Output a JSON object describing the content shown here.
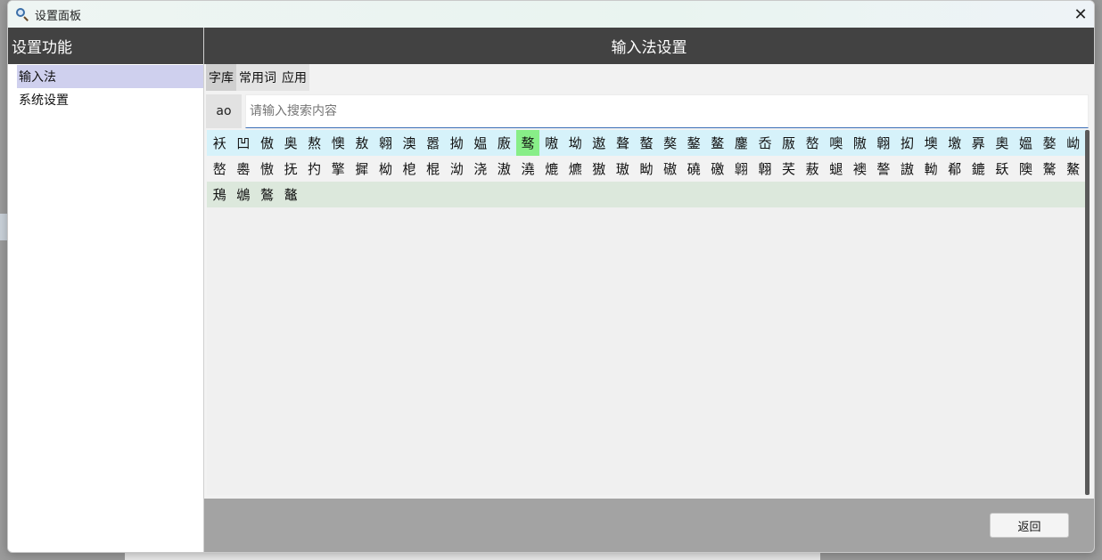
{
  "window": {
    "title": "设置面板",
    "close_glyph": "✕"
  },
  "sidebar": {
    "header": "设置功能",
    "items": [
      {
        "label": "输入法",
        "active": true
      },
      {
        "label": "系统设置",
        "active": false
      }
    ]
  },
  "main": {
    "header": "输入法设置",
    "tabs": [
      {
        "label": "字库",
        "active": true
      },
      {
        "label": "常用词",
        "active": false
      },
      {
        "label": "应用",
        "active": false
      }
    ],
    "search": {
      "pinyin": "ao",
      "placeholder": "请输入搜索内容",
      "value": ""
    },
    "char_rows": [
      [
        "袄",
        "凹",
        "傲",
        "奥",
        "熬",
        "懊",
        "敖",
        "翱",
        "澳",
        "嚣",
        "拗",
        "媪",
        "廒",
        "骜",
        "嗷",
        "坳",
        "遨",
        "聱",
        "螯",
        "獒",
        "鏊",
        "鳌",
        "鏖",
        "岙",
        "厫",
        "嶅",
        "噢",
        "隞",
        "翺",
        "抝",
        "墺",
        "墽",
        "奡",
        "奧",
        "媼",
        "嫯",
        "岰"
      ],
      [
        "嶅",
        "嶴",
        "慠",
        "抚",
        "扚",
        "擎",
        "摨",
        "柪",
        "梎",
        "棍",
        "泑",
        "浇",
        "滶",
        "澆",
        "熝",
        "爊",
        "獓",
        "璈",
        "眑",
        "磝",
        "磽",
        "礉",
        "翶",
        "翺",
        "芺",
        "蔜",
        "螁",
        "襖",
        "謷",
        "謸",
        "軪",
        "郩",
        "鏕",
        "镺",
        "隩",
        "驁",
        "鰲"
      ],
      [
        "鴁",
        "鴢",
        "鷔",
        "鼇"
      ]
    ],
    "highlighted": {
      "row": 0,
      "index": 13
    },
    "back_button": "返回"
  },
  "colors": {
    "header_bg": "#424242",
    "active_sidebar": "#cfd0ee",
    "highlight_char": "#88ee88",
    "row_alt_1": "#d6f2fa",
    "row_alt_3": "#dce8dc",
    "footer_bg": "#a3a3a3"
  },
  "icons": {
    "app": "magnifier-icon",
    "close": "close-icon"
  }
}
